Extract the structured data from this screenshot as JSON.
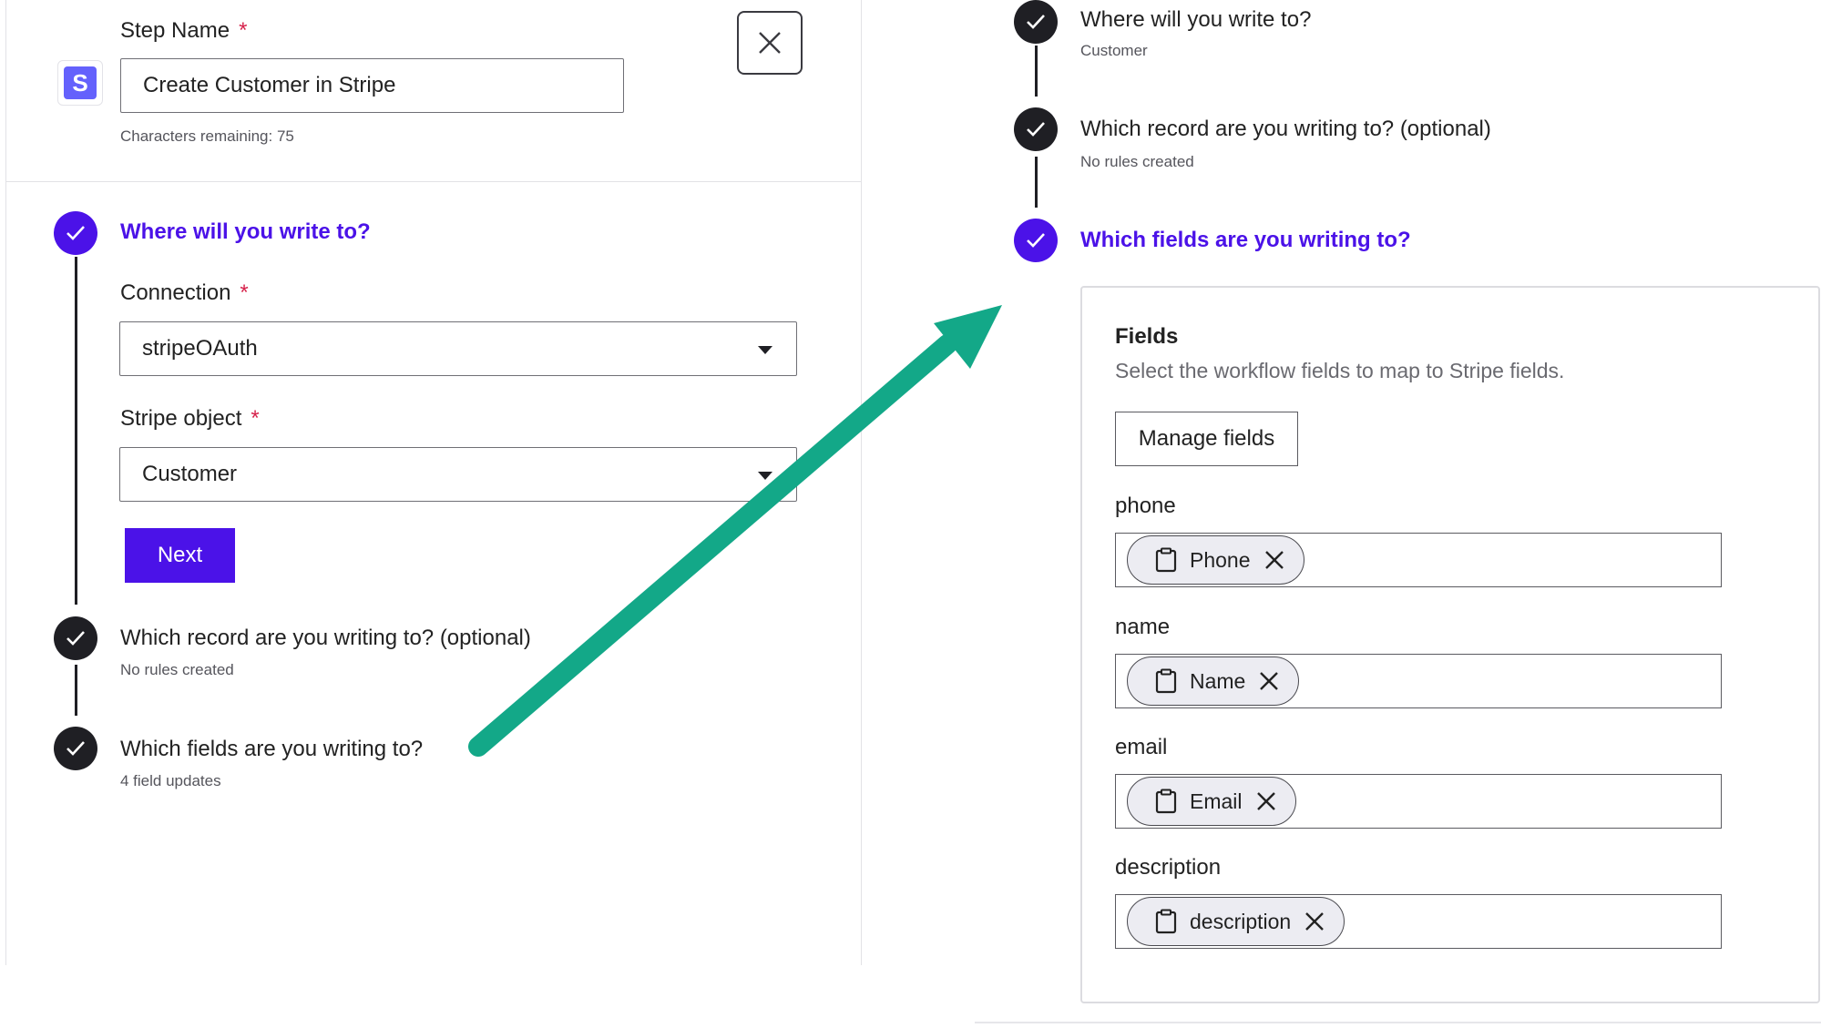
{
  "left": {
    "step_name_label": "Step Name",
    "required_mark": "*",
    "step_name_value": "Create Customer in Stripe",
    "chars_remaining": "Characters remaining: 75",
    "logo_letter": "S",
    "steps": {
      "where": {
        "title": "Where will you write to?"
      },
      "connection": {
        "label": "Connection",
        "value": "stripeOAuth"
      },
      "stripe_object": {
        "label": "Stripe object",
        "value": "Customer"
      },
      "next_label": "Next",
      "record": {
        "title": "Which record are you writing to? (optional)",
        "subtitle": "No rules created"
      },
      "fields": {
        "title": "Which fields are you writing to?",
        "subtitle": "4 field updates"
      }
    }
  },
  "right": {
    "steps": {
      "where": {
        "title": "Where will you write to?",
        "subtitle": "Customer"
      },
      "record": {
        "title": "Which record are you writing to? (optional)",
        "subtitle": "No rules created"
      },
      "fields": {
        "title": "Which fields are you writing to?"
      }
    },
    "card": {
      "title": "Fields",
      "description": "Select the workflow fields to map to Stripe fields.",
      "manage_label": "Manage fields",
      "fields": [
        {
          "label": "phone",
          "chip": "Phone"
        },
        {
          "label": "name",
          "chip": "Name"
        },
        {
          "label": "email",
          "chip": "Email"
        },
        {
          "label": "description",
          "chip": "description"
        }
      ]
    }
  },
  "colors": {
    "accent": "#4b12e8",
    "dark": "#1f1f24",
    "arrow": "#13a888",
    "required": "#d6224b"
  }
}
